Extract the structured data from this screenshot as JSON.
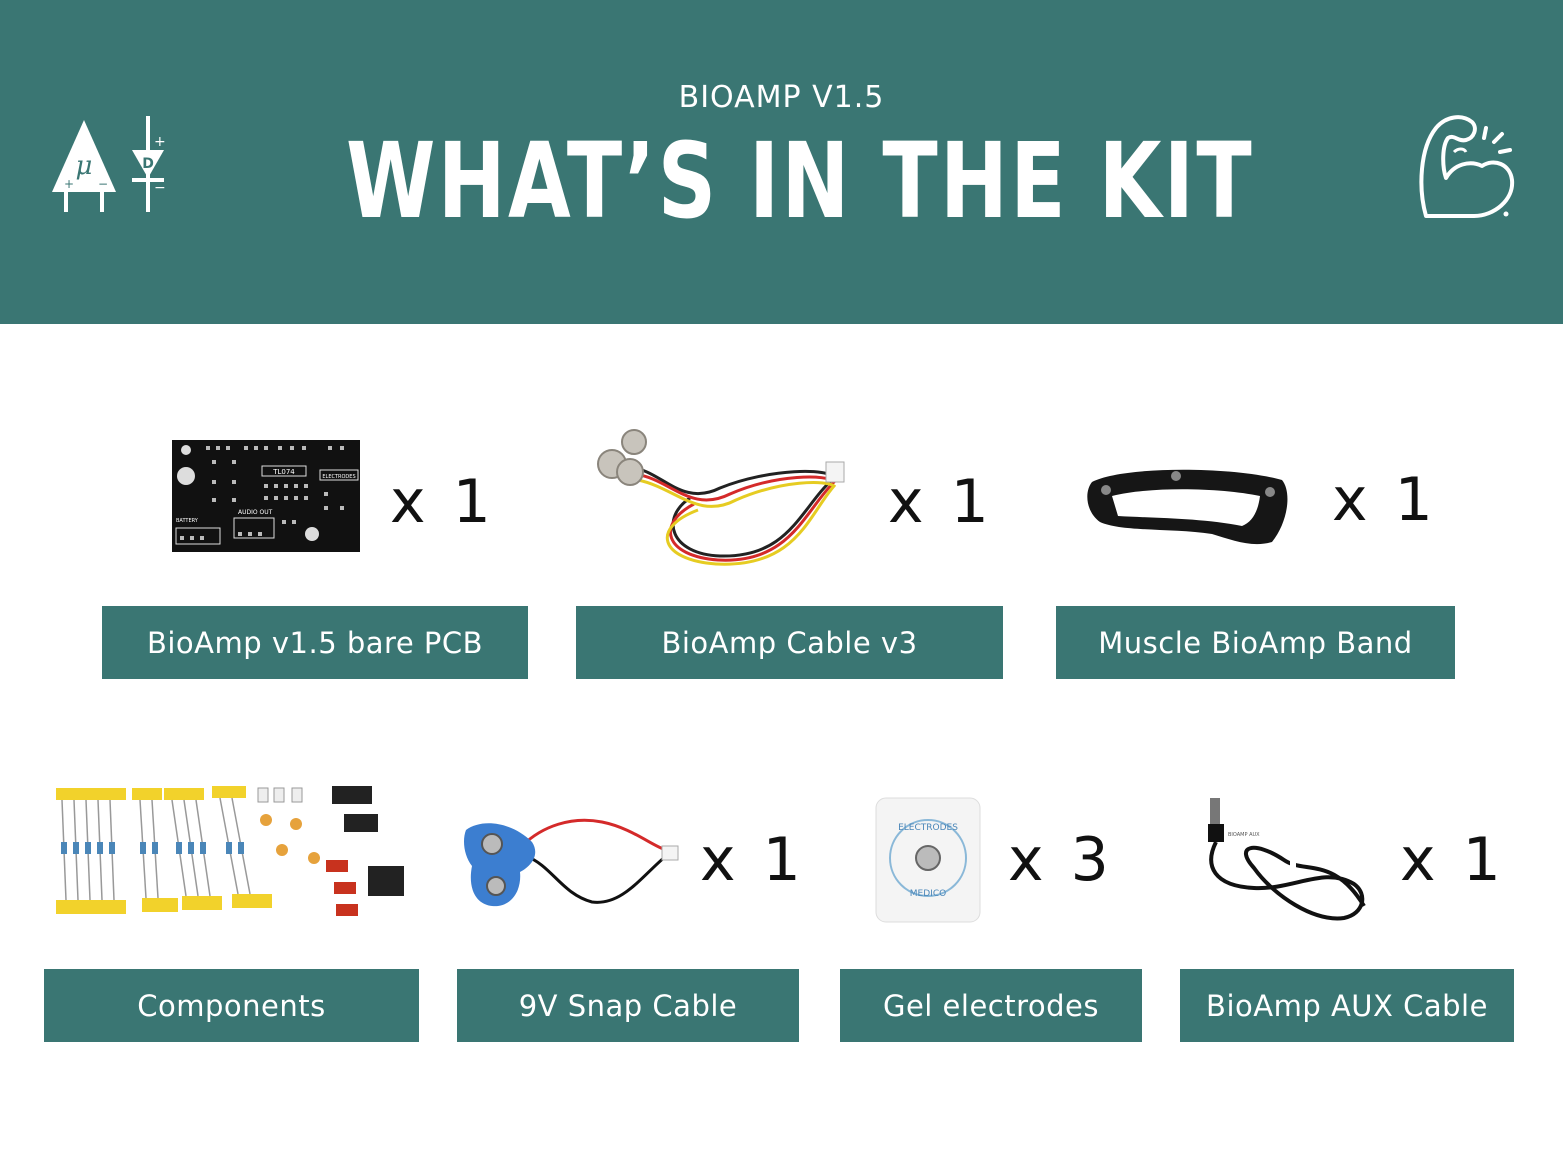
{
  "header": {
    "subtitle": "BIOAMP V1.5",
    "title": "WHAT’S IN THE KIT",
    "left_logo_symbol": "μ",
    "left_logo_diode_letter": "D",
    "background_color": "#3a7673"
  },
  "items": [
    {
      "label": "BioAmp v1.5 bare PCB",
      "quantity": "x 1",
      "icon": "pcb-icon"
    },
    {
      "label": "BioAmp Cable v3",
      "quantity": "x 1",
      "icon": "snap-cable-icon"
    },
    {
      "label": "Muscle BioAmp Band",
      "quantity": "x 1",
      "icon": "band-icon"
    },
    {
      "label": "Components",
      "quantity": "",
      "icon": "components-icon"
    },
    {
      "label": "9V Snap Cable",
      "quantity": "x 1",
      "icon": "battery-snap-icon"
    },
    {
      "label": "Gel electrodes",
      "quantity": "x 3",
      "icon": "gel-electrode-icon"
    },
    {
      "label": "BioAmp AUX Cable",
      "quantity": "x 1",
      "icon": "aux-cable-icon"
    }
  ],
  "pcb_silkscreen": [
    "TL074",
    "ELECTRODES",
    "BATTERY",
    "AUDIO OUT"
  ],
  "electrode_print": [
    "ELECTRODES",
    "MEDICO"
  ],
  "aux_print": "BIOAMP AUX",
  "colors": {
    "accent": "#3a7673",
    "text_dark": "#111111",
    "label_text": "#ffffff"
  }
}
